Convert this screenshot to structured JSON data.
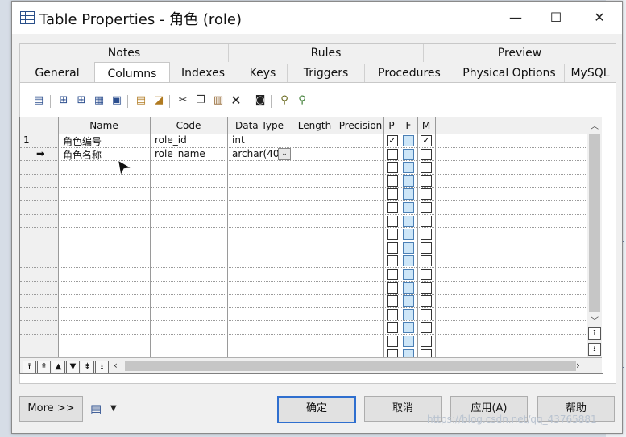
{
  "window": {
    "title": "Table Properties - 角色 (role)",
    "minimize": "—",
    "maximize": "☐",
    "close": "✕"
  },
  "tabs_top": [
    "Notes",
    "Rules",
    "Preview"
  ],
  "tabs_bottom": [
    "General",
    "Columns",
    "Indexes",
    "Keys",
    "Triggers",
    "Procedures",
    "Physical Options",
    "MySQL"
  ],
  "active_tab": "Columns",
  "grid": {
    "headers": [
      "Name",
      "Code",
      "Data Type",
      "Length",
      "Precision",
      "P",
      "F",
      "M"
    ],
    "rows": [
      {
        "marker": "1",
        "name": "角色编号",
        "code": "role_id",
        "data_type": "int",
        "length": "",
        "precision": "",
        "P": true,
        "F": false,
        "M": true
      },
      {
        "marker": "➡",
        "name": "角色名称",
        "code": "role_name",
        "data_type": "archar(40)",
        "length": "",
        "precision": "",
        "P": false,
        "F": false,
        "M": false
      }
    ]
  },
  "buttons": {
    "more": "More >>",
    "ok": "确定",
    "cancel": "取消",
    "apply": "应用(A)",
    "help": "帮助"
  },
  "watermark": "https://blog.csdn.net/qq_43765881"
}
